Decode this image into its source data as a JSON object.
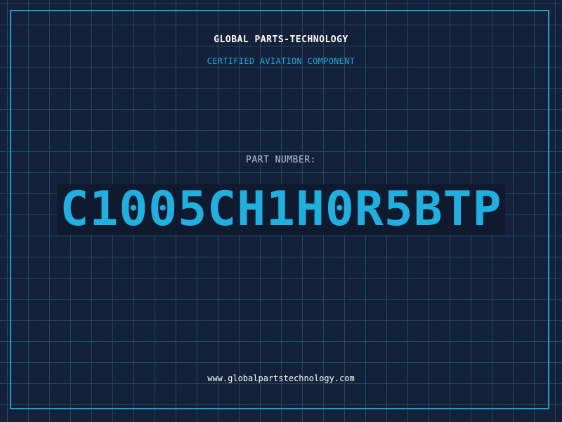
{
  "brand": {
    "name": "GLOBAL PARTS-TECHNOLOGY",
    "tagline": "CERTIFIED AVIATION COMPONENT"
  },
  "part": {
    "label": "PART NUMBER:",
    "number": "C1005CH1H0R5BTP"
  },
  "footer": {
    "url": "www.globalpartstechnology.com"
  },
  "colors": {
    "background": "#14213a",
    "grid": "#1d4a5e",
    "accent": "#1fb0e0",
    "frame": "#1fa0c8"
  }
}
